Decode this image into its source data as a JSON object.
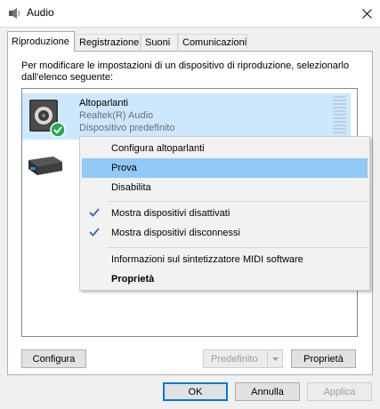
{
  "window": {
    "title": "Audio"
  },
  "tabs": [
    {
      "label": "Riproduzione"
    },
    {
      "label": "Registrazione"
    },
    {
      "label": "Suoni"
    },
    {
      "label": "Comunicazioni"
    }
  ],
  "instructions": "Per modificare le impostazioni di un dispositivo di riproduzione, selezionarlo dall'elenco seguente:",
  "devices": [
    {
      "name": "Altoparlanti",
      "driver": "Realtek(R) Audio",
      "status": "Dispositivo predefinito",
      "icon": "speaker-icon"
    },
    {
      "icon": "hdmi-device-icon"
    }
  ],
  "context_menu": {
    "items": [
      {
        "label": "Configura altoparlanti"
      },
      {
        "label": "Prova"
      },
      {
        "label": "Disabilita"
      },
      {
        "label": "Mostra dispositivi disattivati"
      },
      {
        "label": "Mostra dispositivi disconnessi"
      },
      {
        "label": "Informazioni sul sintetizzatore MIDI software"
      },
      {
        "label": "Proprietà"
      }
    ]
  },
  "panel_buttons": {
    "configure": "Configura",
    "default": "Predefinito",
    "properties": "Proprietà"
  },
  "dialog_buttons": {
    "ok": "OK",
    "cancel": "Annulla",
    "apply": "Applica"
  },
  "colors": {
    "selection": "#cce8ff",
    "menu_highlight": "#91c9f7",
    "accent": "#0078d7",
    "check": "#2d6bbf",
    "default_badge": "#2aa84f"
  }
}
